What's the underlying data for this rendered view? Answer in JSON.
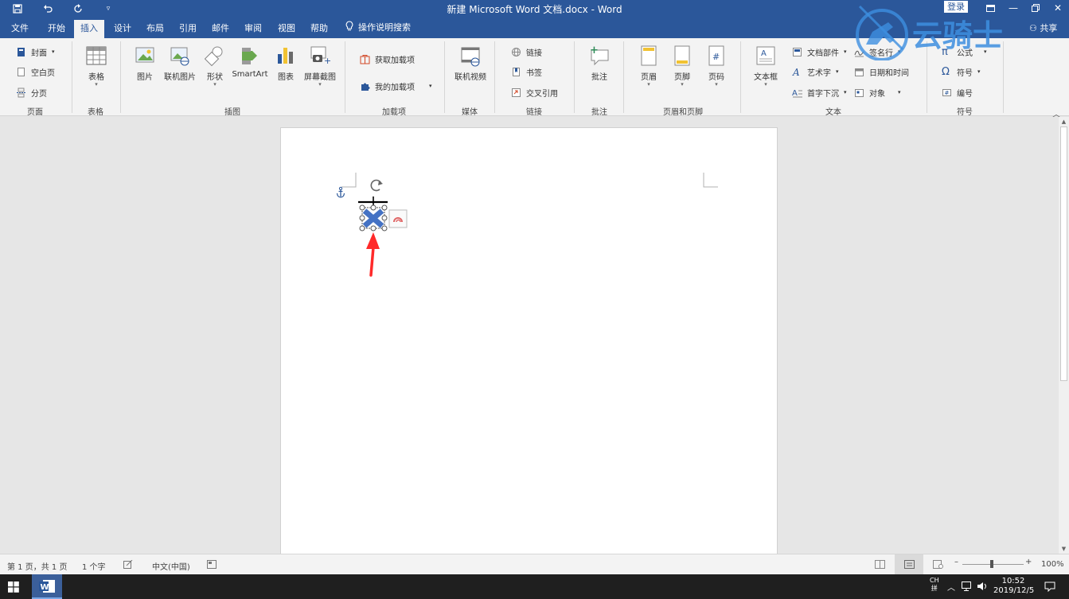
{
  "titlebar": {
    "doc_title": "新建 Microsoft Word 文档.docx - Word",
    "login": "登录",
    "qa_icons": [
      "save-icon",
      "undo-icon",
      "redo-icon",
      "customize-icon"
    ]
  },
  "tabs": [
    "文件",
    "开始",
    "插入",
    "设计",
    "布局",
    "引用",
    "邮件",
    "审阅",
    "视图",
    "帮助"
  ],
  "active_tab": "插入",
  "tellme": "操作说明搜索",
  "share": "共享",
  "ribbon": {
    "pages": {
      "cover": "封面",
      "blank": "空白页",
      "break": "分页",
      "label": "页面"
    },
    "tables": {
      "table": "表格",
      "label": "表格"
    },
    "illustrations": {
      "picture": "图片",
      "online_picture": "联机图片",
      "shapes": "形状",
      "smartart": "SmartArt",
      "chart": "图表",
      "screenshot": "屏幕截图",
      "label": "插图"
    },
    "addins": {
      "get": "获取加载项",
      "my": "我的加载项",
      "label": "加载项"
    },
    "media": {
      "video": "联机视频",
      "label": "媒体"
    },
    "links": {
      "link": "链接",
      "bookmark": "书签",
      "crossref": "交叉引用",
      "label": "链接"
    },
    "comments": {
      "comment": "批注",
      "label": "批注"
    },
    "header_footer": {
      "header": "页眉",
      "footer": "页脚",
      "page_number": "页码",
      "label": "页眉和页脚"
    },
    "text": {
      "textbox": "文本框",
      "quick_parts": "文档部件",
      "wordart": "艺术字",
      "dropcap": "首字下沉",
      "signature": "签名行",
      "datetime": "日期和时间",
      "object": "对象",
      "label": "文本"
    },
    "symbols": {
      "equation": "公式",
      "symbol": "符号",
      "numbering": "编号",
      "label": "符号"
    }
  },
  "status": {
    "page": "第 1 页，共 1 页",
    "words": "1 个字",
    "language": "中文(中国)",
    "zoom": "100%"
  },
  "taskbar": {
    "ime_top": "CH",
    "ime_bottom": "拼",
    "time": "10:52",
    "date": "2019/12/5"
  },
  "watermark": {
    "text": "云骑士"
  },
  "colors": {
    "accent": "#2b579a",
    "ribbon_bg": "#f3f3f3",
    "arrow": "#ff2a2a",
    "selection": "#4472c4"
  }
}
